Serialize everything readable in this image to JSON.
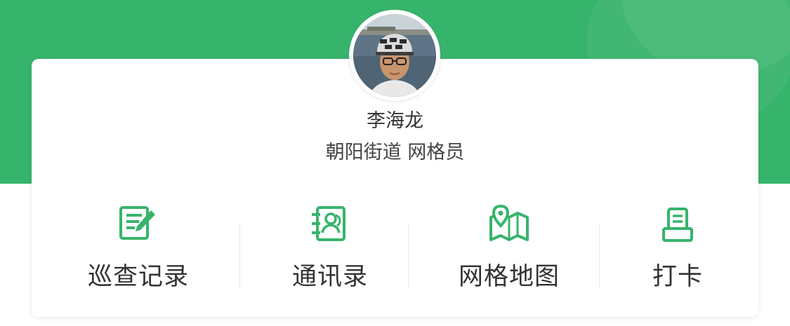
{
  "theme": {
    "accent": "#37b46c",
    "text": "#333333"
  },
  "profile": {
    "name": "李海龙",
    "role": "朝阳街道 网格员",
    "avatar_icon": "user-photo"
  },
  "menu": [
    {
      "label": "巡查记录",
      "icon": "notepad-edit-icon"
    },
    {
      "label": "通讯录",
      "icon": "contacts-icon"
    },
    {
      "label": "网格地图",
      "icon": "map-pin-icon"
    },
    {
      "label": "打卡",
      "icon": "clock-in-icon"
    }
  ]
}
